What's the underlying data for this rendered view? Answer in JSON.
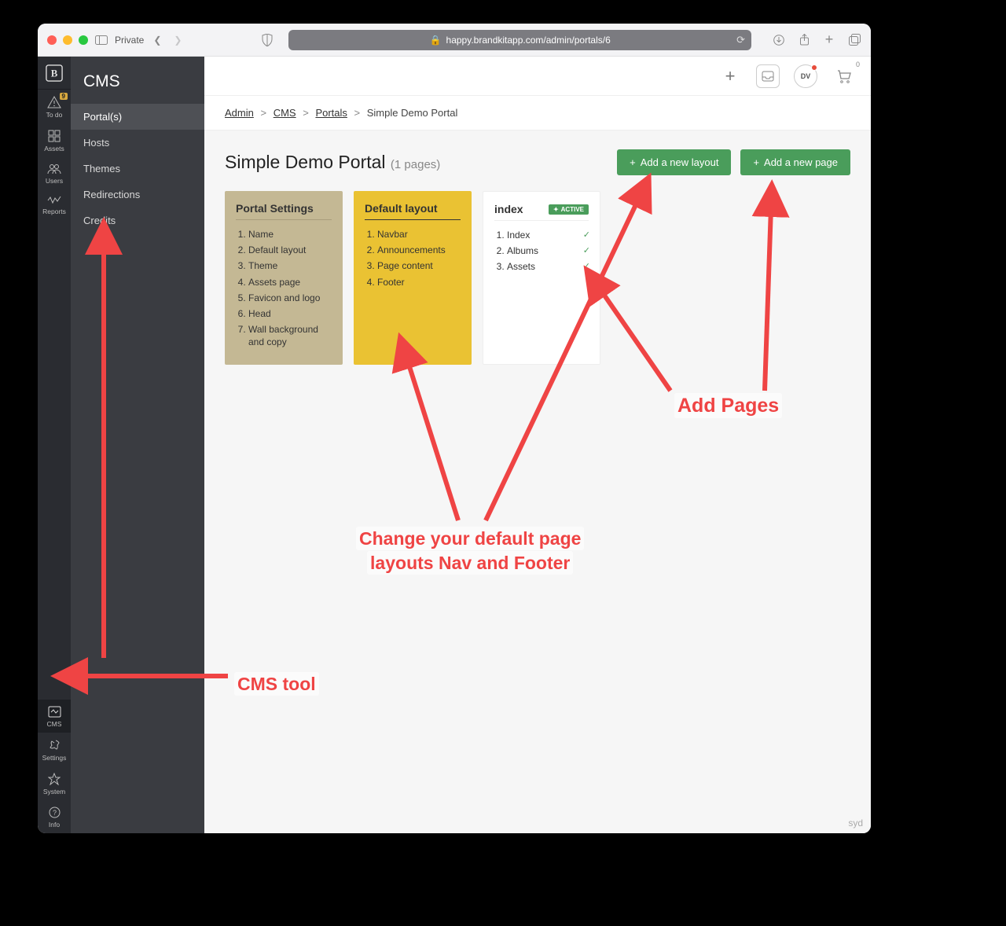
{
  "browser": {
    "private_label": "Private",
    "url_display": "happy.brandkitapp.com/admin/portals/6"
  },
  "sidebar_a": {
    "items": [
      {
        "name": "todo",
        "label": "To do",
        "badge": "9"
      },
      {
        "name": "assets",
        "label": "Assets"
      },
      {
        "name": "users",
        "label": "Users"
      },
      {
        "name": "reports",
        "label": "Reports"
      }
    ],
    "bottom": [
      {
        "name": "cms",
        "label": "CMS"
      },
      {
        "name": "settings",
        "label": "Settings"
      },
      {
        "name": "system",
        "label": "System"
      },
      {
        "name": "info",
        "label": "Info"
      }
    ]
  },
  "sidebar_b": {
    "title": "CMS",
    "items": [
      {
        "label": "Portal(s)",
        "active": true
      },
      {
        "label": "Hosts"
      },
      {
        "label": "Themes"
      },
      {
        "label": "Redirections"
      },
      {
        "label": "Credits"
      }
    ]
  },
  "topbar": {
    "avatar_initials": "DV",
    "cart_count": "0"
  },
  "breadcrumbs": [
    {
      "label": "Admin",
      "link": true
    },
    {
      "label": "CMS",
      "link": true
    },
    {
      "label": "Portals",
      "link": true
    },
    {
      "label": "Simple Demo Portal",
      "link": false
    }
  ],
  "page": {
    "title": "Simple Demo Portal",
    "subtitle": "(1 pages)",
    "btn_layout": "Add a new layout",
    "btn_page": "Add a new page"
  },
  "cards": {
    "settings": {
      "title": "Portal Settings",
      "items": [
        "Name",
        "Default layout",
        "Theme",
        "Assets page",
        "Favicon and logo",
        "Head",
        "Wall background and copy"
      ]
    },
    "layout": {
      "title": "Default layout",
      "items": [
        "Navbar",
        "Announcements",
        "Page content",
        "Footer"
      ]
    },
    "index": {
      "title": "index",
      "active_label": "ACTIVE",
      "items": [
        "Index",
        "Albums",
        "Assets"
      ]
    }
  },
  "footer_brand": "syd",
  "annotations": {
    "add_pages": "Add Pages",
    "change_layout_l1": "Change your default page",
    "change_layout_l2": "layouts Nav and Footer",
    "cms_tool": "CMS tool"
  }
}
